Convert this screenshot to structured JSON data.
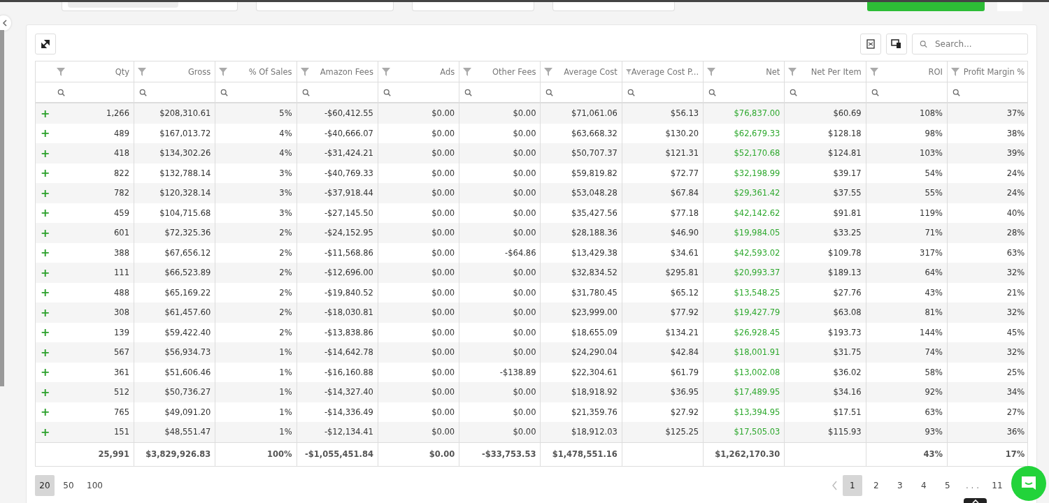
{
  "toolbar": {
    "search": {
      "placeholder": "Search..."
    }
  },
  "table": {
    "columns": [
      "Qty",
      "Gross",
      "% Of Sales",
      "Amazon Fees",
      "Ads",
      "Other Fees",
      "Average Cost",
      "Average Cost P...",
      "Net",
      "Net Per Item",
      "ROI",
      "Profit Margin %"
    ],
    "rows": [
      {
        "expander": "+",
        "cells": [
          "1,266",
          "$208,310.61",
          "5%",
          "-$60,412.55",
          "$0.00",
          "$0.00",
          "$71,061.06",
          "$56.13",
          "$76,837.00",
          "$60.69",
          "108%",
          "37%"
        ]
      },
      {
        "expander": "+",
        "cells": [
          "489",
          "$167,013.72",
          "4%",
          "-$40,666.07",
          "$0.00",
          "$0.00",
          "$63,668.32",
          "$130.20",
          "$62,679.33",
          "$128.18",
          "98%",
          "38%"
        ]
      },
      {
        "expander": "+",
        "cells": [
          "418",
          "$134,302.26",
          "4%",
          "-$31,424.21",
          "$0.00",
          "$0.00",
          "$50,707.37",
          "$121.31",
          "$52,170.68",
          "$124.81",
          "103%",
          "39%"
        ]
      },
      {
        "expander": "+",
        "cells": [
          "822",
          "$132,788.14",
          "3%",
          "-$40,769.33",
          "$0.00",
          "$0.00",
          "$59,819.82",
          "$72.77",
          "$32,198.99",
          "$39.17",
          "54%",
          "24%"
        ]
      },
      {
        "expander": "+",
        "cells": [
          "782",
          "$120,328.14",
          "3%",
          "-$37,918.44",
          "$0.00",
          "$0.00",
          "$53,048.28",
          "$67.84",
          "$29,361.42",
          "$37.55",
          "55%",
          "24%"
        ]
      },
      {
        "expander": "+",
        "cells": [
          "459",
          "$104,715.68",
          "3%",
          "-$27,145.50",
          "$0.00",
          "$0.00",
          "$35,427.56",
          "$77.18",
          "$42,142.62",
          "$91.81",
          "119%",
          "40%"
        ]
      },
      {
        "expander": "+",
        "cells": [
          "601",
          "$72,325.36",
          "2%",
          "-$24,152.95",
          "$0.00",
          "$0.00",
          "$28,188.36",
          "$46.90",
          "$19,984.05",
          "$33.25",
          "71%",
          "28%"
        ]
      },
      {
        "expander": "+",
        "cells": [
          "388",
          "$67,656.12",
          "2%",
          "-$11,568.86",
          "$0.00",
          "-$64.86",
          "$13,429.38",
          "$34.61",
          "$42,593.02",
          "$109.78",
          "317%",
          "63%"
        ]
      },
      {
        "expander": "+",
        "cells": [
          "111",
          "$66,523.89",
          "2%",
          "-$12,696.00",
          "$0.00",
          "$0.00",
          "$32,834.52",
          "$295.81",
          "$20,993.37",
          "$189.13",
          "64%",
          "32%"
        ]
      },
      {
        "expander": "+",
        "cells": [
          "488",
          "$65,169.22",
          "2%",
          "-$19,840.52",
          "$0.00",
          "$0.00",
          "$31,780.45",
          "$65.12",
          "$13,548.25",
          "$27.76",
          "43%",
          "21%"
        ]
      },
      {
        "expander": "+",
        "cells": [
          "308",
          "$61,457.60",
          "2%",
          "-$18,030.81",
          "$0.00",
          "$0.00",
          "$23,999.00",
          "$77.92",
          "$19,427.79",
          "$63.08",
          "81%",
          "32%"
        ]
      },
      {
        "expander": "+",
        "cells": [
          "139",
          "$59,422.40",
          "2%",
          "-$13,838.86",
          "$0.00",
          "$0.00",
          "$18,655.09",
          "$134.21",
          "$26,928.45",
          "$193.73",
          "144%",
          "45%"
        ]
      },
      {
        "expander": "+",
        "cells": [
          "567",
          "$56,934.73",
          "1%",
          "-$14,642.78",
          "$0.00",
          "$0.00",
          "$24,290.04",
          "$42.84",
          "$18,001.91",
          "$31.75",
          "74%",
          "32%"
        ]
      },
      {
        "expander": "+",
        "cells": [
          "361",
          "$51,606.46",
          "1%",
          "-$16,160.88",
          "$0.00",
          "-$138.89",
          "$22,304.61",
          "$61.79",
          "$13,002.08",
          "$36.02",
          "58%",
          "25%"
        ]
      },
      {
        "expander": "+",
        "cells": [
          "512",
          "$50,736.27",
          "1%",
          "-$14,327.40",
          "$0.00",
          "$0.00",
          "$18,918.92",
          "$36.95",
          "$17,489.95",
          "$34.16",
          "92%",
          "34%"
        ]
      },
      {
        "expander": "+",
        "cells": [
          "765",
          "$49,091.20",
          "1%",
          "-$14,336.49",
          "$0.00",
          "$0.00",
          "$21,359.76",
          "$27.92",
          "$13,394.95",
          "$17.51",
          "63%",
          "27%"
        ]
      },
      {
        "expander": "+",
        "cells": [
          "151",
          "$48,551.47",
          "1%",
          "-$12,134.41",
          "$0.00",
          "$0.00",
          "$18,912.03",
          "$125.25",
          "$17,505.03",
          "$115.93",
          "93%",
          "36%"
        ]
      }
    ],
    "totals": [
      {
        "kind": "value",
        "text": "25,991"
      },
      {
        "kind": "value",
        "text": "$3,829,926.83"
      },
      {
        "kind": "value",
        "text": "100%"
      },
      {
        "kind": "value",
        "text": "-$1,055,451.84"
      },
      {
        "kind": "value",
        "text": "$0.00"
      },
      {
        "kind": "value",
        "text": "-$33,753.53"
      },
      {
        "kind": "value",
        "text": "$1,478,551.16"
      },
      {
        "kind": "empty"
      },
      {
        "kind": "value",
        "text": "$1,262,170.30"
      },
      {
        "kind": "empty"
      },
      {
        "kind": "value",
        "text": "43%"
      },
      {
        "kind": "value",
        "text": "17%"
      }
    ]
  },
  "pager": {
    "page_sizes": [
      {
        "label": "20",
        "selected": true
      },
      {
        "label": "50",
        "selected": false
      },
      {
        "label": "100",
        "selected": false
      }
    ],
    "pages": [
      {
        "label": "1",
        "kind": "page",
        "selected": true
      },
      {
        "label": "2",
        "kind": "page",
        "selected": false
      },
      {
        "label": "3",
        "kind": "page",
        "selected": false
      },
      {
        "label": "4",
        "kind": "page",
        "selected": false
      },
      {
        "label": "5",
        "kind": "page",
        "selected": false
      },
      {
        "label": ". . .",
        "kind": "ellipsis"
      },
      {
        "label": "11",
        "kind": "page",
        "selected": false
      }
    ]
  }
}
